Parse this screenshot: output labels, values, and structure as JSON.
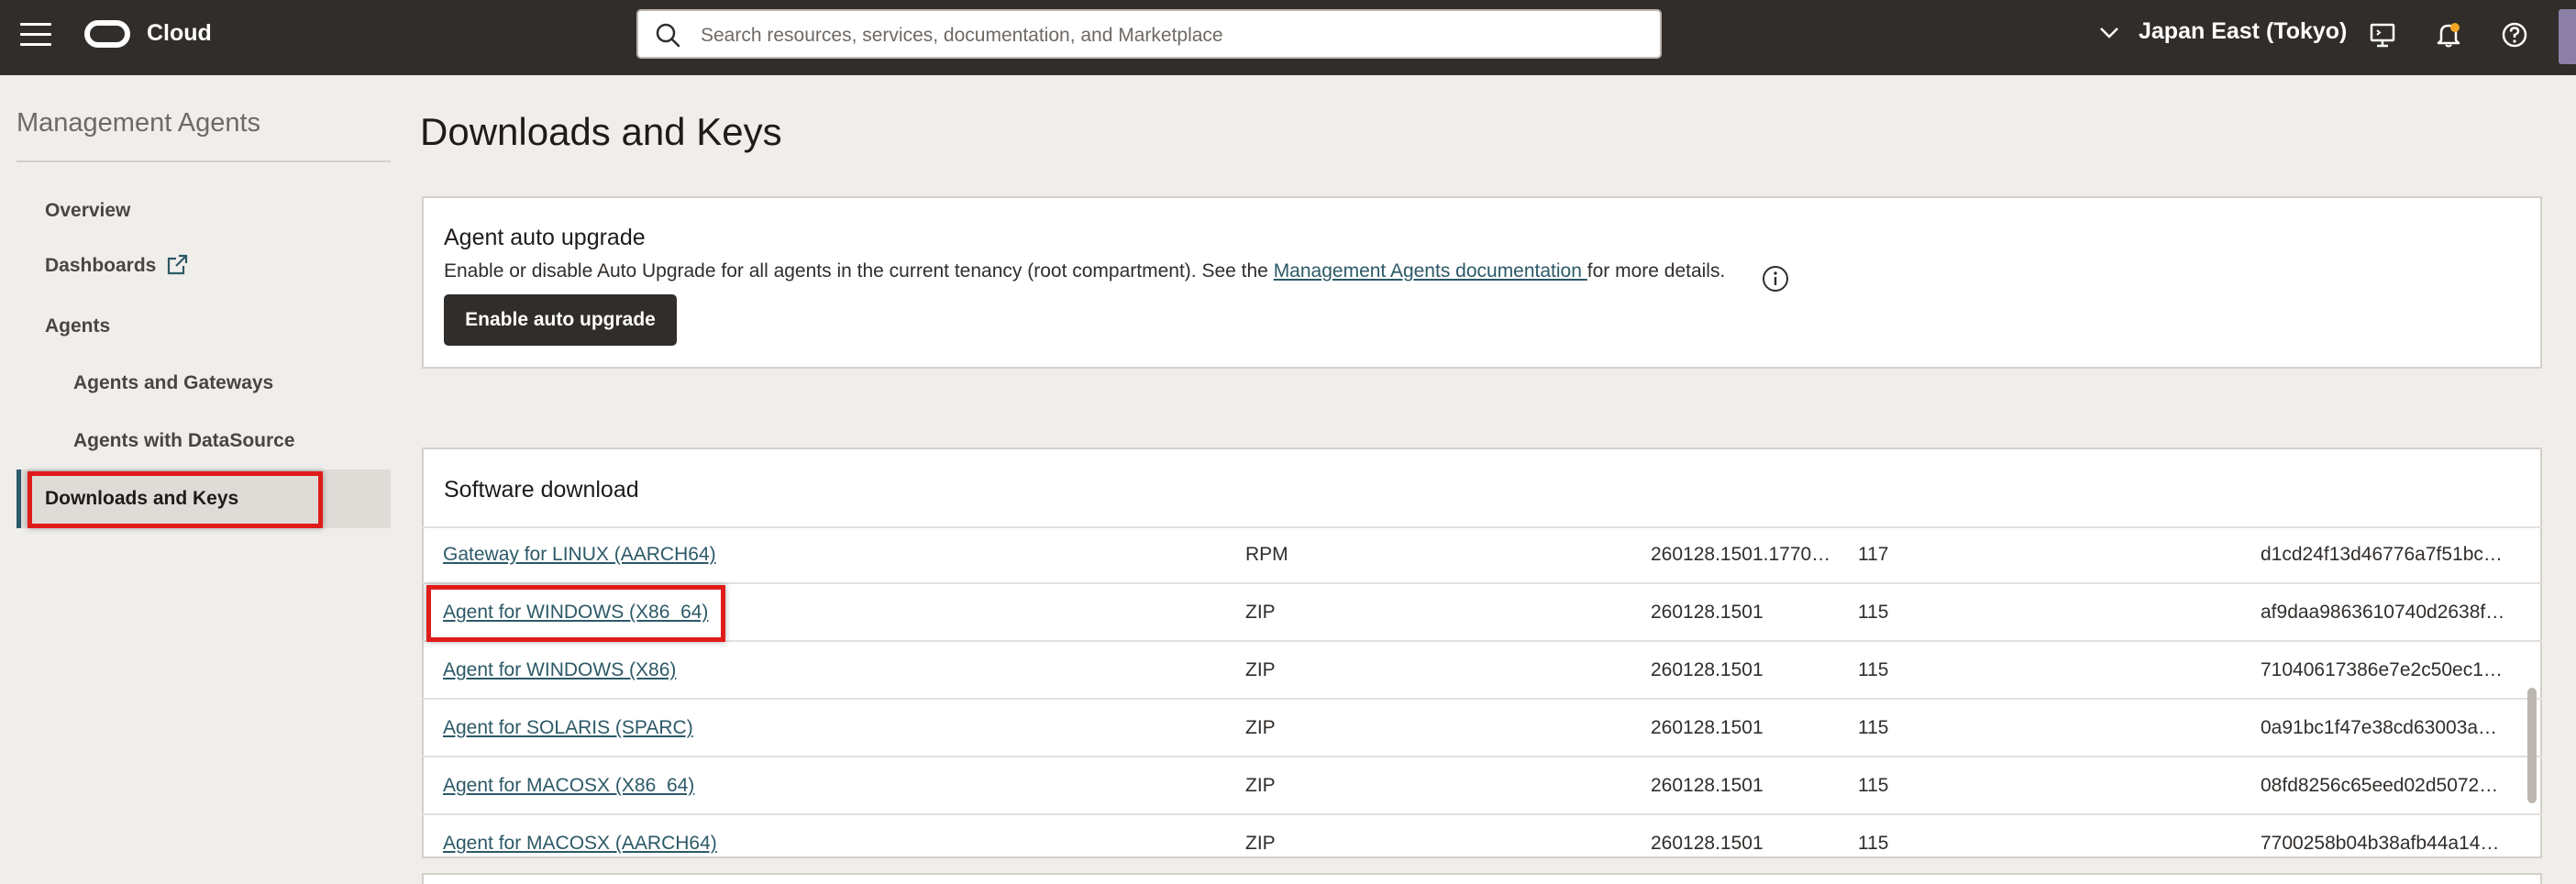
{
  "topbar": {
    "brand": "Cloud",
    "search_placeholder": "Search resources, services, documentation, and Marketplace",
    "region": "Japan East (Tokyo)"
  },
  "nav": {
    "title": "Management Agents",
    "items": [
      {
        "label": "Overview"
      },
      {
        "label": "Dashboards"
      },
      {
        "label": "Agents"
      },
      {
        "label": "Agents and Gateways"
      },
      {
        "label": "Agents with DataSource"
      },
      {
        "label": "Downloads and Keys"
      }
    ]
  },
  "main": {
    "title": "Downloads and Keys",
    "auto_upgrade": {
      "title": "Agent auto upgrade",
      "desc_before": "Enable or disable Auto Upgrade for all agents in the current tenancy (root compartment). See the ",
      "desc_link": "Management Agents documentation ",
      "desc_after": "for more details.",
      "button": "Enable auto upgrade"
    },
    "software": {
      "title": "Software download",
      "rows": [
        {
          "name": "Gateway for LINUX (AARCH64)",
          "type": "RPM",
          "version": "260128.1501.1770…",
          "size": "117",
          "checksum": "d1cd24f13d46776a7f51bc…"
        },
        {
          "name": "Agent for WINDOWS (X86_64)",
          "type": "ZIP",
          "version": "260128.1501",
          "size": "115",
          "checksum": "af9daa9863610740d2638f…"
        },
        {
          "name": "Agent for WINDOWS (X86)",
          "type": "ZIP",
          "version": "260128.1501",
          "size": "115",
          "checksum": "71040617386e7e2c50ec1…"
        },
        {
          "name": "Agent for SOLARIS (SPARC)",
          "type": "ZIP",
          "version": "260128.1501",
          "size": "115",
          "checksum": "0a91bc1f47e38cd63003a…"
        },
        {
          "name": "Agent for MACOSX (X86_64)",
          "type": "ZIP",
          "version": "260128.1501",
          "size": "115",
          "checksum": "08fd8256c65eed02d5072…"
        },
        {
          "name": "Agent for MACOSX (AARCH64)",
          "type": "ZIP",
          "version": "260128.1501",
          "size": "115",
          "checksum": "7700258b04b38afb44a14…"
        }
      ]
    }
  },
  "icons": {
    "menu": "hamburger-menu-icon",
    "logo": "oracle-logo",
    "search": "search-icon",
    "region": "chevron-down-icon",
    "cloud_shell": "cloud-shell-icon",
    "notifications": "bell-icon",
    "help": "help-icon",
    "external_link": "external-link-icon",
    "info": "info-icon"
  },
  "colors": {
    "topbar_bg": "#312d2a",
    "link": "#2c5967",
    "highlight": "#e01b1b",
    "notification_dot": "#f5a623"
  }
}
